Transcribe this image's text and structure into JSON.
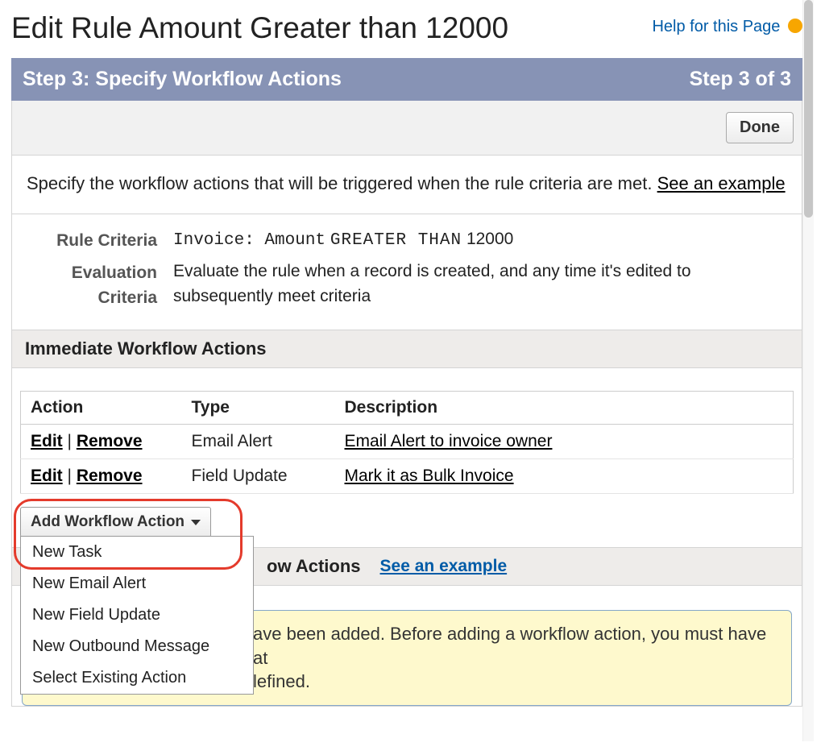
{
  "header": {
    "title": "Edit Rule Amount Greater than 12000",
    "help_link": "Help for this Page"
  },
  "step_bar": {
    "left": "Step 3: Specify Workflow Actions",
    "right": "Step 3 of 3"
  },
  "toolbar": {
    "done": "Done"
  },
  "instruction": {
    "text": "Specify the workflow actions that will be triggered when the rule criteria are met. ",
    "see_example": "See an example"
  },
  "criteria": {
    "rule_label": "Rule Criteria",
    "rule_value_prefix": "Invoice: Amount",
    "rule_value_op": "GREATER THAN",
    "rule_value_num": "12000",
    "eval_label": "Evaluation Criteria",
    "eval_value": "Evaluate the rule when a record is created, and any time it's edited to subsequently meet criteria"
  },
  "immediate": {
    "heading": "Immediate Workflow Actions",
    "columns": {
      "action": "Action",
      "type": "Type",
      "description": "Description"
    },
    "edit_label": "Edit",
    "remove_label": "Remove",
    "rows": [
      {
        "type": "Email Alert",
        "description": "Email Alert to invoice owner"
      },
      {
        "type": "Field Update",
        "description": "Mark it as Bulk Invoice"
      }
    ],
    "add_button": "Add Workflow Action",
    "menu": [
      "New Task",
      "New Email Alert",
      "New Field Update",
      "New Outbound Message",
      "Select Existing Action"
    ]
  },
  "timedep": {
    "heading_suffix": "ow Actions",
    "see_example": "See an example",
    "warn_suffix": "ave been added. Before adding a workflow action, you must have at",
    "warn_line2_suffix": "lefined."
  }
}
